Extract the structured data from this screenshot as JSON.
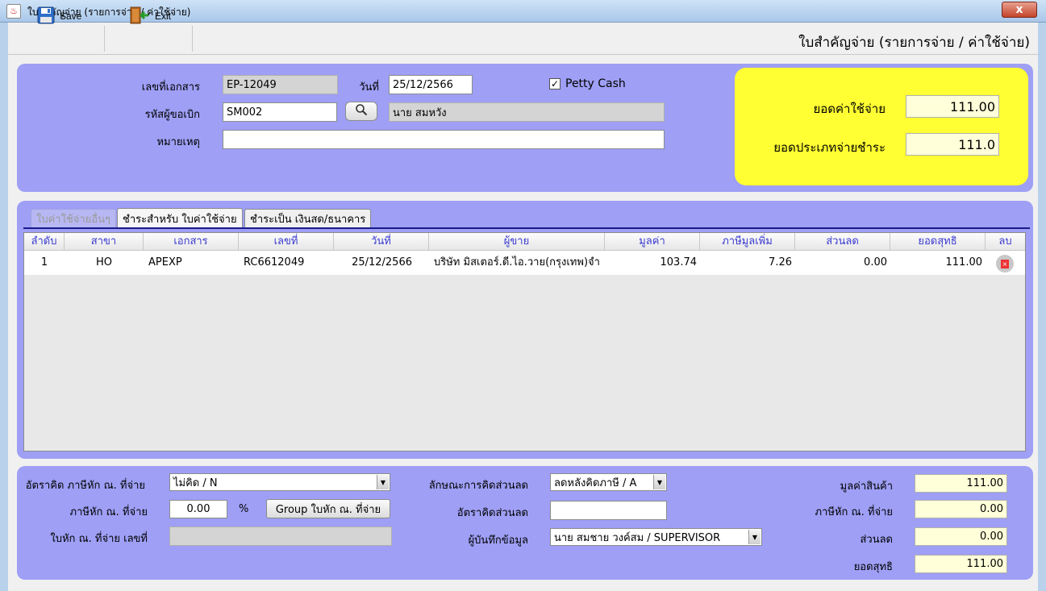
{
  "window": {
    "title": "ใบสำคัญจ่าย (รายการจ่าย / ค่าใช้จ่าย)",
    "close": "x"
  },
  "toolbar": {
    "save_label": "Save",
    "exit_label": "Exit"
  },
  "page_title": "ใบสำคัญจ่าย (รายการจ่าย / ค่าใช้จ่าย)",
  "header": {
    "doc_no_label": "เลขที่เอกสาร",
    "doc_no": "EP-12049",
    "date_label": "วันที่",
    "date": "25/12/2566",
    "petty_cash_label": "Petty Cash",
    "petty_cash_checked": true,
    "requester_label": "รหัสผู้ขอเบิก",
    "requester_code": "SM002",
    "requester_name": "นาย สมหวัง",
    "remark_label": "หมายเหตุ",
    "remark": ""
  },
  "summary": {
    "expense_total_label": "ยอดค่าใช้จ่าย",
    "expense_total": "111.00",
    "payment_total_label": "ยอดประเภทจ่ายชำระ",
    "payment_total": "111.0"
  },
  "tabs": [
    {
      "label": "ใบค่าใช้จ่ายอื่นๆ",
      "state": "disabled"
    },
    {
      "label": "ชำระสำหรับ ใบค่าใช้จ่าย",
      "state": "active"
    },
    {
      "label": "ชำระเป็น เงินสด/ธนาคาร",
      "state": "normal"
    }
  ],
  "table": {
    "columns": [
      "ลำดับ",
      "สาขา",
      "เอกสาร",
      "เลขที่",
      "วันที่",
      "ผู้ขาย",
      "มูลค่า",
      "ภาษีมูลเพิ่ม",
      "ส่วนลด",
      "ยอดสุทธิ",
      "ลบ"
    ],
    "rows": [
      {
        "seq": "1",
        "branch": "HO",
        "doc": "APEXP",
        "no": "RC6612049",
        "date": "25/12/2566",
        "vendor": "บริษัท มิสเตอร์.ดี.ไอ.วาย(กรุงเทพ)จำ",
        "amount": "103.74",
        "vat": "7.26",
        "discount": "0.00",
        "net": "111.00"
      }
    ]
  },
  "footer": {
    "wht_rate_label": "อัตราคิด ภาษีหัก ณ. ที่จ่าย",
    "wht_rate": "ไม่คิด / N",
    "wht_label": "ภาษีหัก ณ. ที่จ่าย",
    "wht_value": "0.00",
    "percent": "%",
    "group_button": "Group ใบหัก ณ. ที่จ่าย",
    "wht_doc_label": "ใบหัก ณ. ที่จ่าย เลขที่",
    "wht_doc": "",
    "discount_type_label": "ลักษณะการคิดส่วนลด",
    "discount_type": "ลดหลังคิดภาษี / A",
    "discount_rate_label": "อัตราคิดส่วนลด",
    "discount_rate": "",
    "recorder_label": "ผู้บันทึกข้อมูล",
    "recorder": "นาย สมชาย วงค์สม / SUPERVISOR",
    "goods_value_label": "มูลค่าสินค้า",
    "goods_value": "111.00",
    "wht_total_label": "ภาษีหัก ณ. ที่จ่าย",
    "wht_total": "0.00",
    "discount_label": "ส่วนลด",
    "discount": "0.00",
    "net_label": "ยอดสุทธิ",
    "net": "111.00"
  },
  "colors": {
    "panel": "#9e9ff5",
    "summary_box": "#ffff33",
    "header_text": "#3a3ad0"
  }
}
